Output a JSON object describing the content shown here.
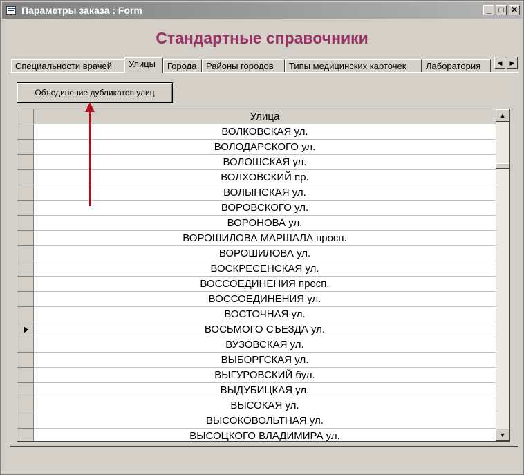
{
  "window": {
    "title": "Параметры заказа : Form",
    "minimize_glyph": "_",
    "maximize_glyph": "□",
    "close_glyph": "✕"
  },
  "heading": "Стандартные справочники",
  "tabs": [
    {
      "label": "Специальности врачей"
    },
    {
      "label": "Улицы"
    },
    {
      "label": "Города"
    },
    {
      "label": "Районы городов"
    },
    {
      "label": "Типы медицинских карточек"
    },
    {
      "label": "Лаборатория"
    }
  ],
  "active_tab": "Улицы",
  "tab_scroll": {
    "left_glyph": "◀",
    "right_glyph": "▶"
  },
  "merge_button": {
    "label": "Объединение дубликатов улиц"
  },
  "grid": {
    "column_header": "Улица",
    "current_row_index": 13,
    "rows": [
      "ВОЛКОВСКАЯ ул.",
      "ВОЛОДАРСКОГО ул.",
      "ВОЛОШСКАЯ ул.",
      "ВОЛХОВСКИЙ пр.",
      "ВОЛЫНСКАЯ ул.",
      "ВОРОВСКОГО ул.",
      "ВОРОНОВА ул.",
      "ВОРОШИЛОВА МАРШАЛА просп.",
      "ВОРОШИЛОВА ул.",
      "ВОСКРЕСЕНСКАЯ ул.",
      "ВОССОЕДИНЕНИЯ просп.",
      "ВОССОЕДИНЕНИЯ ул.",
      "ВОСТОЧНАЯ ул.",
      "ВОСЬМОГО  СЪЕЗДА ул.",
      "ВУЗОВСКАЯ ул.",
      "ВЫБОРГСКАЯ ул.",
      "ВЫГУРОВСКИЙ бул.",
      "ВЫДУБИЦКАЯ ул.",
      "ВЫСОКАЯ ул.",
      "ВЫСОКОВОЛЬТНАЯ ул.",
      "ВЫСОЦКОГО ВЛАДИМИРА ул."
    ],
    "scroll_up_glyph": "▲",
    "scroll_down_glyph": "▼"
  },
  "colors": {
    "heading": "#993366",
    "annotation_arrow": "#b01020"
  }
}
